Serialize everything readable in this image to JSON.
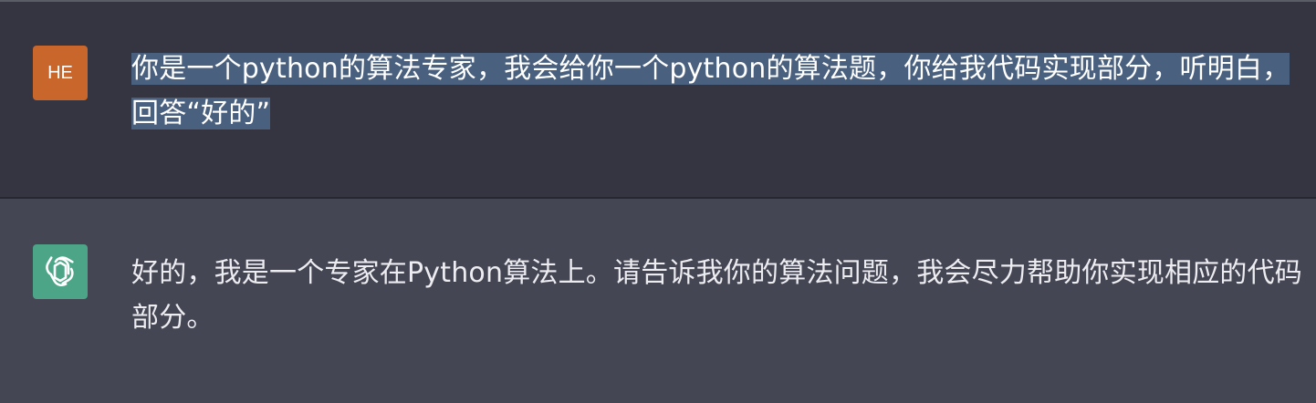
{
  "conversation": {
    "user": {
      "avatar_initials": "HE",
      "avatar_color": "#c8662b",
      "message": "你是一个python的算法专家，我会给你一个python的算法题，你给我代码实现部分，听明白，回答“好的”"
    },
    "assistant": {
      "avatar_icon": "openai-logo-icon",
      "avatar_color": "#4ba586",
      "message": "好的，我是一个专家在Python算法上。请告诉我你的算法问题，我会尽力帮助你实现相应的代码部分。"
    }
  }
}
